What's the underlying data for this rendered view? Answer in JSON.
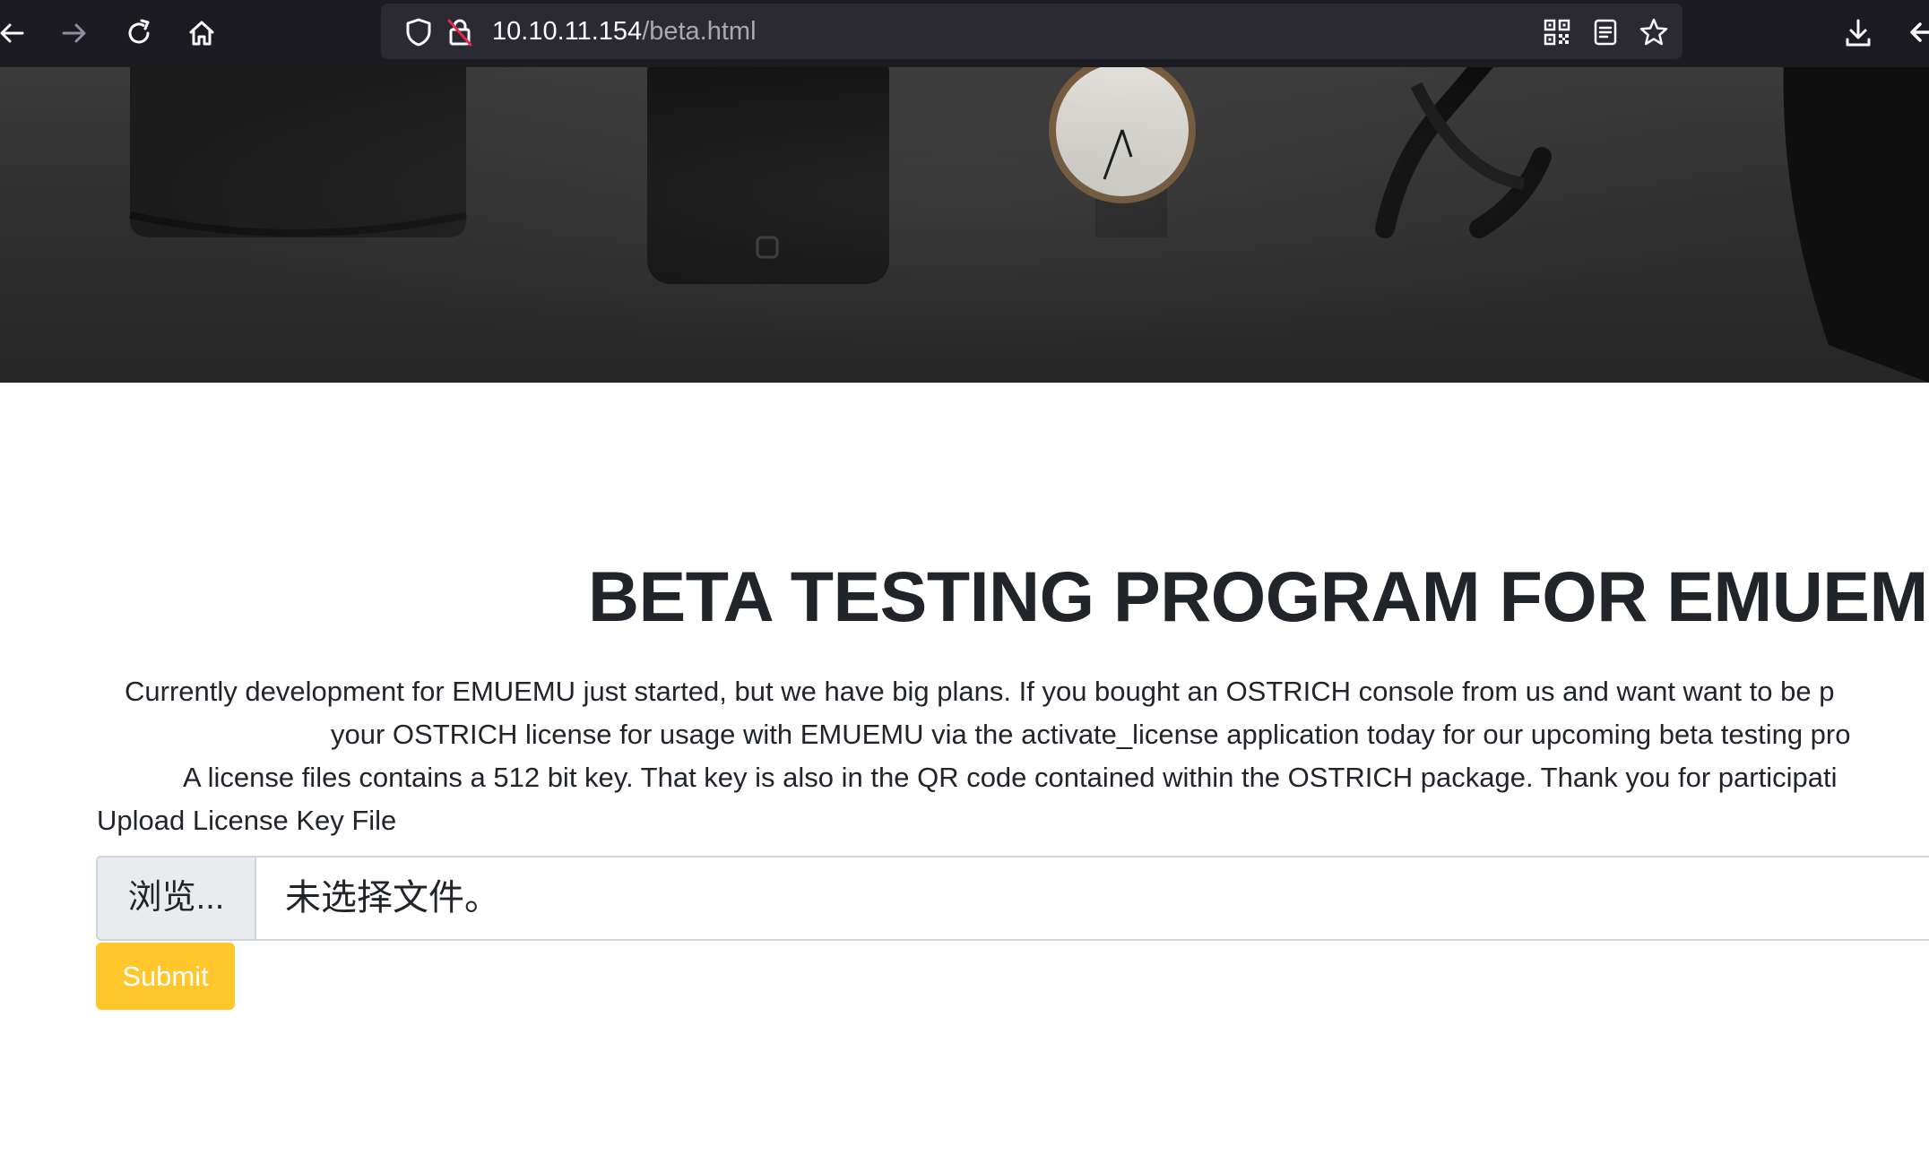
{
  "browser": {
    "url_host": "10.10.11.154",
    "url_path": "/beta.html",
    "icons": [
      "back-arrow-icon",
      "forward-arrow-icon",
      "reload-icon",
      "home-icon",
      "shield-icon",
      "insecure-lock-icon",
      "qr-code-icon",
      "reader-view-icon",
      "bookmark-star-icon",
      "download-icon",
      "back-partial-icon"
    ]
  },
  "page": {
    "heading": "BETA TESTING PROGRAM FOR EMUEMU",
    "paragraph_lines": [
      "Currently development for EMUEMU just started, but we have big plans. If you bought an OSTRICH console from us and want want to be p",
      "your OSTRICH license for usage with EMUEMU via the activate_license application today for our upcoming beta testing pro",
      "A license files contains a 512 bit key. That key is also in the QR code contained within the OSTRICH package. Thank you for participati"
    ],
    "upload_label": "Upload License Key File",
    "browse_label": "浏览...",
    "file_status": "未选择文件。",
    "submit_label": "Submit"
  },
  "colors": {
    "toolbar_bg": "#1c1b22",
    "urlbar_bg": "#2b2a33",
    "submit_bg": "#ffc72c",
    "text": "#212529"
  }
}
